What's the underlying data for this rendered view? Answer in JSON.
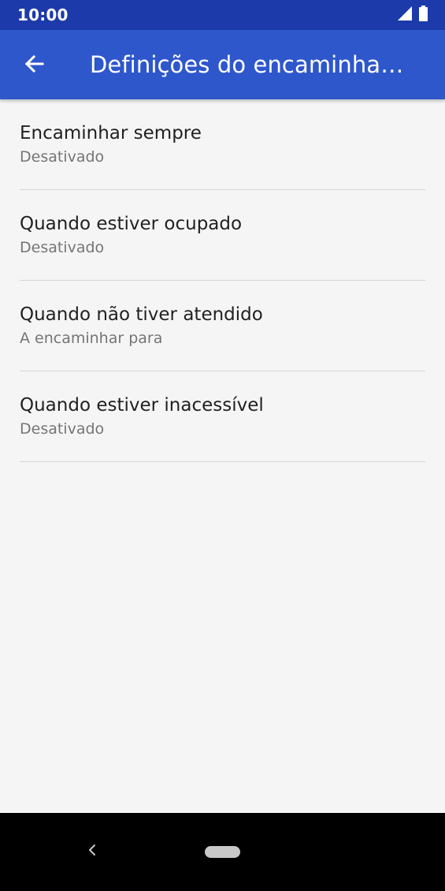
{
  "status_bar": {
    "time": "10:00",
    "icons": [
      "signal-icon",
      "battery-icon"
    ]
  },
  "app_bar": {
    "title": "Definições do encaminham…",
    "back_icon": "arrow-left-icon"
  },
  "settings": {
    "items": [
      {
        "title": "Encaminhar sempre",
        "subtitle": "Desativado"
      },
      {
        "title": "Quando estiver ocupado",
        "subtitle": "Desativado"
      },
      {
        "title": "Quando não tiver atendido",
        "subtitle": "A encaminhar para"
      },
      {
        "title": "Quando estiver inacessível",
        "subtitle": "Desativado"
      }
    ]
  },
  "nav_bar": {
    "back_icon": "nav-back-icon",
    "home_icon": "home-pill-icon"
  },
  "colors": {
    "status_bar": "#1d3aaa",
    "app_bar": "#2f57cc",
    "background": "#f5f5f5",
    "title_text": "#212121",
    "subtitle_text": "#757575",
    "nav_bar": "#000000"
  }
}
